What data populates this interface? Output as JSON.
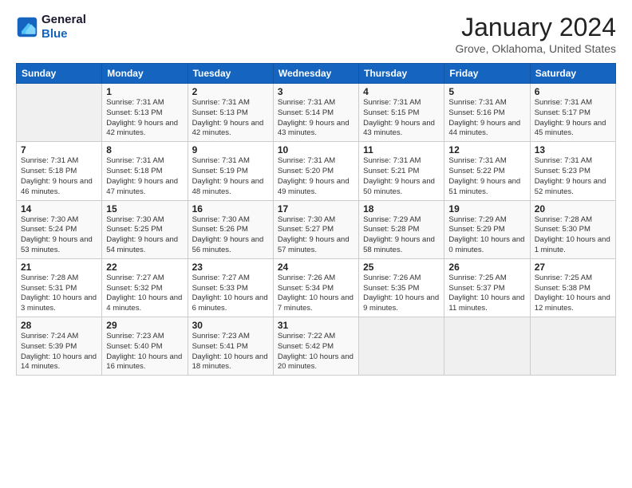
{
  "header": {
    "logo_line1": "General",
    "logo_line2": "Blue",
    "month": "January 2024",
    "location": "Grove, Oklahoma, United States"
  },
  "weekdays": [
    "Sunday",
    "Monday",
    "Tuesday",
    "Wednesday",
    "Thursday",
    "Friday",
    "Saturday"
  ],
  "weeks": [
    [
      {
        "day": "",
        "sunrise": "",
        "sunset": "",
        "daylight": ""
      },
      {
        "day": "1",
        "sunrise": "Sunrise: 7:31 AM",
        "sunset": "Sunset: 5:13 PM",
        "daylight": "Daylight: 9 hours and 42 minutes."
      },
      {
        "day": "2",
        "sunrise": "Sunrise: 7:31 AM",
        "sunset": "Sunset: 5:13 PM",
        "daylight": "Daylight: 9 hours and 42 minutes."
      },
      {
        "day": "3",
        "sunrise": "Sunrise: 7:31 AM",
        "sunset": "Sunset: 5:14 PM",
        "daylight": "Daylight: 9 hours and 43 minutes."
      },
      {
        "day": "4",
        "sunrise": "Sunrise: 7:31 AM",
        "sunset": "Sunset: 5:15 PM",
        "daylight": "Daylight: 9 hours and 43 minutes."
      },
      {
        "day": "5",
        "sunrise": "Sunrise: 7:31 AM",
        "sunset": "Sunset: 5:16 PM",
        "daylight": "Daylight: 9 hours and 44 minutes."
      },
      {
        "day": "6",
        "sunrise": "Sunrise: 7:31 AM",
        "sunset": "Sunset: 5:17 PM",
        "daylight": "Daylight: 9 hours and 45 minutes."
      }
    ],
    [
      {
        "day": "7",
        "sunrise": "Sunrise: 7:31 AM",
        "sunset": "Sunset: 5:18 PM",
        "daylight": "Daylight: 9 hours and 46 minutes."
      },
      {
        "day": "8",
        "sunrise": "Sunrise: 7:31 AM",
        "sunset": "Sunset: 5:18 PM",
        "daylight": "Daylight: 9 hours and 47 minutes."
      },
      {
        "day": "9",
        "sunrise": "Sunrise: 7:31 AM",
        "sunset": "Sunset: 5:19 PM",
        "daylight": "Daylight: 9 hours and 48 minutes."
      },
      {
        "day": "10",
        "sunrise": "Sunrise: 7:31 AM",
        "sunset": "Sunset: 5:20 PM",
        "daylight": "Daylight: 9 hours and 49 minutes."
      },
      {
        "day": "11",
        "sunrise": "Sunrise: 7:31 AM",
        "sunset": "Sunset: 5:21 PM",
        "daylight": "Daylight: 9 hours and 50 minutes."
      },
      {
        "day": "12",
        "sunrise": "Sunrise: 7:31 AM",
        "sunset": "Sunset: 5:22 PM",
        "daylight": "Daylight: 9 hours and 51 minutes."
      },
      {
        "day": "13",
        "sunrise": "Sunrise: 7:31 AM",
        "sunset": "Sunset: 5:23 PM",
        "daylight": "Daylight: 9 hours and 52 minutes."
      }
    ],
    [
      {
        "day": "14",
        "sunrise": "Sunrise: 7:30 AM",
        "sunset": "Sunset: 5:24 PM",
        "daylight": "Daylight: 9 hours and 53 minutes."
      },
      {
        "day": "15",
        "sunrise": "Sunrise: 7:30 AM",
        "sunset": "Sunset: 5:25 PM",
        "daylight": "Daylight: 9 hours and 54 minutes."
      },
      {
        "day": "16",
        "sunrise": "Sunrise: 7:30 AM",
        "sunset": "Sunset: 5:26 PM",
        "daylight": "Daylight: 9 hours and 56 minutes."
      },
      {
        "day": "17",
        "sunrise": "Sunrise: 7:30 AM",
        "sunset": "Sunset: 5:27 PM",
        "daylight": "Daylight: 9 hours and 57 minutes."
      },
      {
        "day": "18",
        "sunrise": "Sunrise: 7:29 AM",
        "sunset": "Sunset: 5:28 PM",
        "daylight": "Daylight: 9 hours and 58 minutes."
      },
      {
        "day": "19",
        "sunrise": "Sunrise: 7:29 AM",
        "sunset": "Sunset: 5:29 PM",
        "daylight": "Daylight: 10 hours and 0 minutes."
      },
      {
        "day": "20",
        "sunrise": "Sunrise: 7:28 AM",
        "sunset": "Sunset: 5:30 PM",
        "daylight": "Daylight: 10 hours and 1 minute."
      }
    ],
    [
      {
        "day": "21",
        "sunrise": "Sunrise: 7:28 AM",
        "sunset": "Sunset: 5:31 PM",
        "daylight": "Daylight: 10 hours and 3 minutes."
      },
      {
        "day": "22",
        "sunrise": "Sunrise: 7:27 AM",
        "sunset": "Sunset: 5:32 PM",
        "daylight": "Daylight: 10 hours and 4 minutes."
      },
      {
        "day": "23",
        "sunrise": "Sunrise: 7:27 AM",
        "sunset": "Sunset: 5:33 PM",
        "daylight": "Daylight: 10 hours and 6 minutes."
      },
      {
        "day": "24",
        "sunrise": "Sunrise: 7:26 AM",
        "sunset": "Sunset: 5:34 PM",
        "daylight": "Daylight: 10 hours and 7 minutes."
      },
      {
        "day": "25",
        "sunrise": "Sunrise: 7:26 AM",
        "sunset": "Sunset: 5:35 PM",
        "daylight": "Daylight: 10 hours and 9 minutes."
      },
      {
        "day": "26",
        "sunrise": "Sunrise: 7:25 AM",
        "sunset": "Sunset: 5:37 PM",
        "daylight": "Daylight: 10 hours and 11 minutes."
      },
      {
        "day": "27",
        "sunrise": "Sunrise: 7:25 AM",
        "sunset": "Sunset: 5:38 PM",
        "daylight": "Daylight: 10 hours and 12 minutes."
      }
    ],
    [
      {
        "day": "28",
        "sunrise": "Sunrise: 7:24 AM",
        "sunset": "Sunset: 5:39 PM",
        "daylight": "Daylight: 10 hours and 14 minutes."
      },
      {
        "day": "29",
        "sunrise": "Sunrise: 7:23 AM",
        "sunset": "Sunset: 5:40 PM",
        "daylight": "Daylight: 10 hours and 16 minutes."
      },
      {
        "day": "30",
        "sunrise": "Sunrise: 7:23 AM",
        "sunset": "Sunset: 5:41 PM",
        "daylight": "Daylight: 10 hours and 18 minutes."
      },
      {
        "day": "31",
        "sunrise": "Sunrise: 7:22 AM",
        "sunset": "Sunset: 5:42 PM",
        "daylight": "Daylight: 10 hours and 20 minutes."
      },
      {
        "day": "",
        "sunrise": "",
        "sunset": "",
        "daylight": ""
      },
      {
        "day": "",
        "sunrise": "",
        "sunset": "",
        "daylight": ""
      },
      {
        "day": "",
        "sunrise": "",
        "sunset": "",
        "daylight": ""
      }
    ]
  ]
}
